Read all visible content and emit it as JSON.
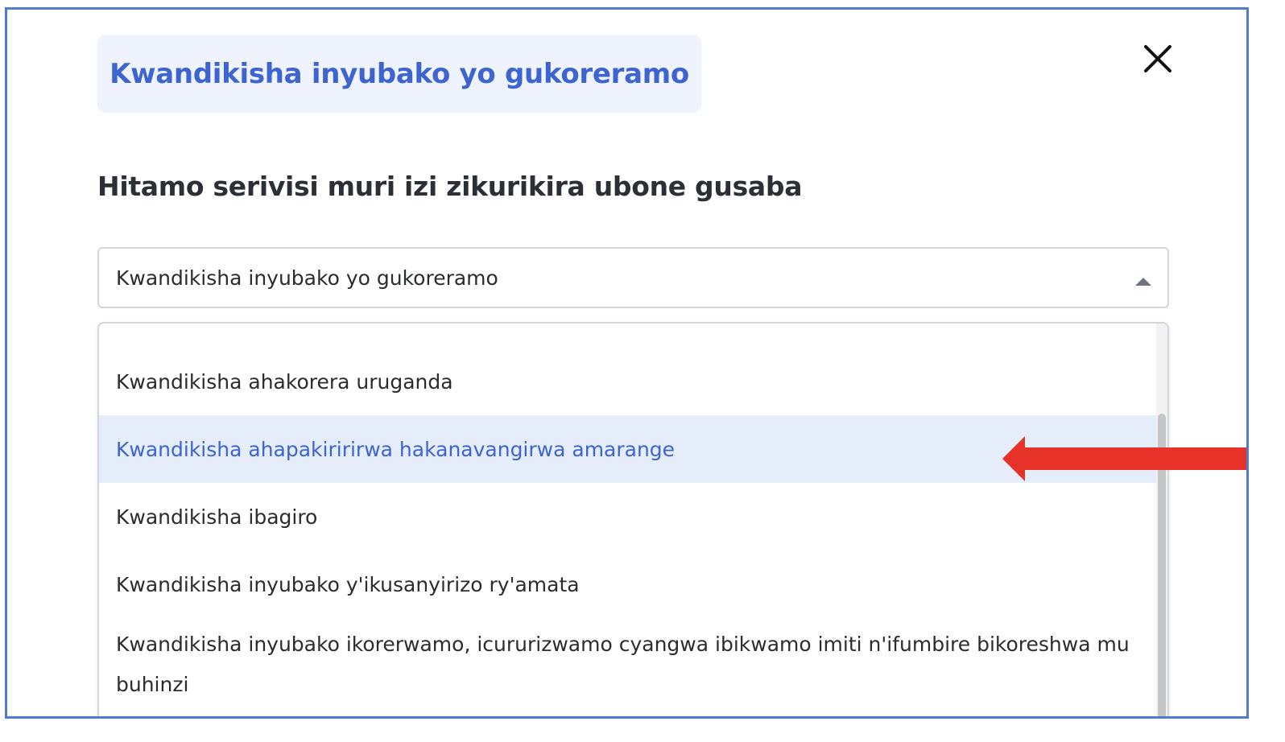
{
  "dialog": {
    "title": "Kwandikisha inyubako yo gukoreramo",
    "prompt": "Hitamo serivisi muri izi zikurikira ubone gusaba",
    "close_icon": "close-icon"
  },
  "select": {
    "selected_value": "Kwandikisha inyubako yo gukoreramo",
    "caret_icon": "caret-up-icon"
  },
  "dropdown": {
    "options": [
      {
        "label": "Kwandikisha ahakorera uruganda",
        "highlighted": false
      },
      {
        "label": "Kwandikisha ahapakiririrwa hakanavangirwa amarange",
        "highlighted": true
      },
      {
        "label": "Kwandikisha ibagiro",
        "highlighted": false
      },
      {
        "label": "Kwandikisha inyubako y'ikusanyirizo ry'amata",
        "highlighted": false
      },
      {
        "label": "Kwandikisha inyubako ikorerwamo, icururizwamo cyangwa ibikwamo imiti n'ifumbire bikoreshwa mu buhinzi",
        "highlighted": false
      }
    ],
    "highlight_color": "#e6edfa",
    "highlight_text_color": "#3d64cf"
  },
  "annotation": {
    "arrow_icon": "red-arrow-icon",
    "arrow_color": "#e63228"
  },
  "colors": {
    "frame_border": "#4f7bd0",
    "title_text": "#3d64cf",
    "title_bg": "#eef3fd"
  }
}
